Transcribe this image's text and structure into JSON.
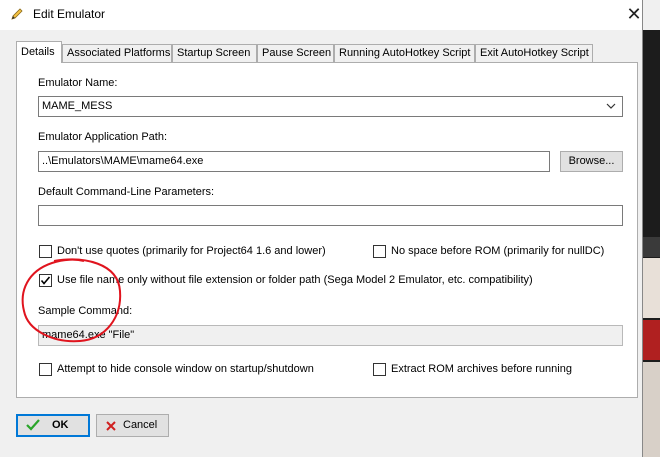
{
  "window": {
    "title": "Edit Emulator",
    "close_glyph": "✕"
  },
  "tabs": [
    {
      "label": "Details",
      "active": true
    },
    {
      "label": "Associated Platforms",
      "active": false
    },
    {
      "label": "Startup Screen",
      "active": false
    },
    {
      "label": "Pause Screen",
      "active": false
    },
    {
      "label": "Running AutoHotkey Script",
      "active": false
    },
    {
      "label": "Exit AutoHotkey Script",
      "active": false
    }
  ],
  "details": {
    "emulator_name_label": "Emulator Name:",
    "emulator_name_value": "MAME_MESS",
    "app_path_label": "Emulator Application Path:",
    "app_path_value": "..\\Emulators\\MAME\\mame64.exe",
    "browse_label": "Browse...",
    "cmdline_label": "Default Command-Line Parameters:",
    "cmdline_value": "",
    "dont_use_quotes_label": "Don't use quotes (primarily for Project64 1.6 and lower)",
    "dont_use_quotes_checked": false,
    "no_space_label": "No space before ROM (primarily for nullDC)",
    "no_space_checked": false,
    "use_filename_only_label": "Use file name only without file extension or folder path (Sega Model 2 Emulator, etc. compatibility)",
    "use_filename_only_checked": true,
    "sample_command_label": "Sample Command:",
    "sample_command_value": "mame64.exe \"File\"",
    "hide_console_label": "Attempt to hide console window on startup/shutdown",
    "hide_console_checked": false,
    "extract_rom_label": "Extract ROM archives before running",
    "extract_rom_checked": false
  },
  "footer": {
    "ok_label": "OK",
    "cancel_label": "Cancel"
  },
  "colors": {
    "annotation_circle": "#e0141e",
    "ok_icon": "#2aa52a",
    "cancel_icon": "#d02020",
    "focus_border": "#0078d7"
  }
}
